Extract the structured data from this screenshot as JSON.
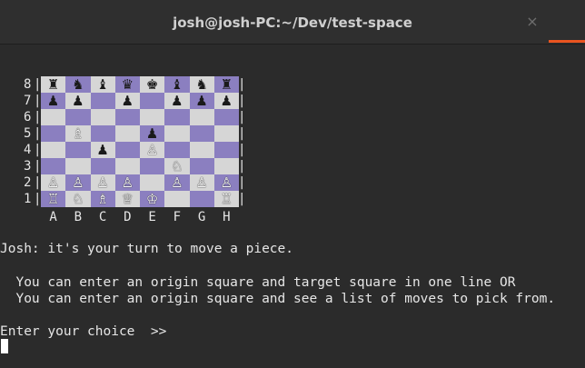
{
  "window": {
    "title": "josh@josh-PC:~/Dev/test-space",
    "close_glyph": "×",
    "accent_color": "#e95420"
  },
  "board": {
    "ranks": [
      "8",
      "7",
      "6",
      "5",
      "4",
      "3",
      "2",
      "1"
    ],
    "files": [
      "A",
      "B",
      "C",
      "D",
      "E",
      "F",
      "G",
      "H"
    ],
    "bar": "|",
    "light_square_color": "#d6d6d6",
    "dark_square_color": "#8b7fc0",
    "rows": [
      [
        "r",
        "n",
        "b",
        "q",
        "k",
        "b",
        "n",
        "r"
      ],
      [
        "p",
        "p",
        "",
        "p",
        "",
        "p",
        "p",
        "p"
      ],
      [
        "",
        "",
        "",
        "",
        "",
        "",
        "",
        ""
      ],
      [
        "",
        "B",
        "",
        "",
        "p",
        "",
        "",
        ""
      ],
      [
        "",
        "",
        "p",
        "",
        "P",
        "",
        "",
        ""
      ],
      [
        "",
        "",
        "",
        "",
        "",
        "N",
        "",
        ""
      ],
      [
        "P",
        "P",
        "P",
        "P",
        "",
        "P",
        "P",
        "P"
      ],
      [
        "R",
        "N",
        "B",
        "Q",
        "K",
        "",
        "",
        "R"
      ]
    ]
  },
  "terminal": {
    "prompt_line": "Josh: it's your turn to move a piece.",
    "option_1": "  You can enter an origin square and target square in one line OR",
    "option_2": "  You can enter an origin square and see a list of moves to pick from.",
    "input_prompt": "Enter your choice  >>",
    "input_value": ""
  }
}
